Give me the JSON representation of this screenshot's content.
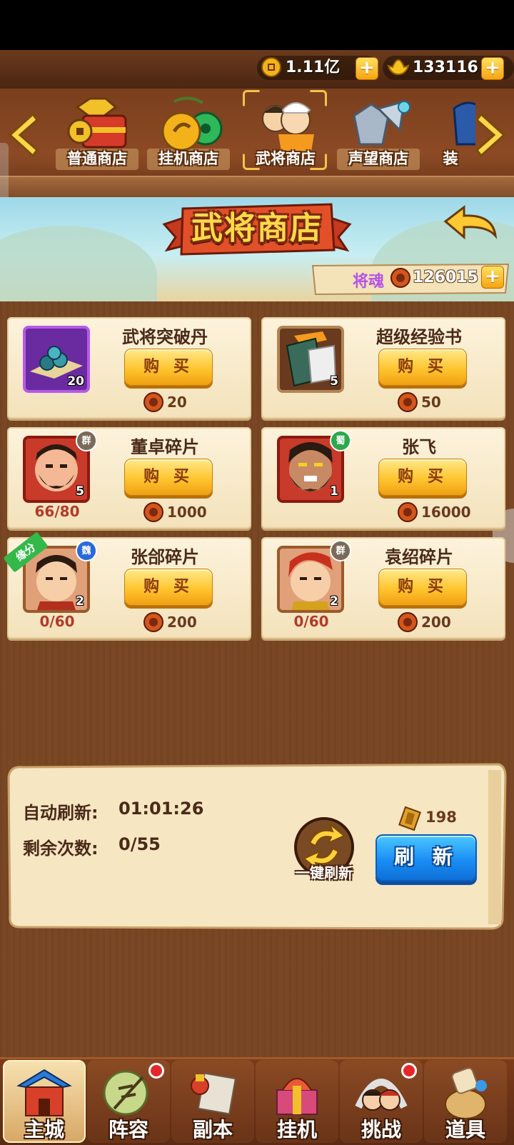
{
  "currency": {
    "coins": "1.11亿",
    "ingots": "133116"
  },
  "shop_tabs": [
    {
      "label": "普通商店",
      "icon": "treasure-chest-icon",
      "selected": false
    },
    {
      "label": "挂机商店",
      "icon": "coin-jade-icon",
      "selected": false
    },
    {
      "label": "武将商店",
      "icon": "general-portrait-icon",
      "selected": true
    },
    {
      "label": "声望商店",
      "icon": "armor-icon",
      "selected": false
    },
    {
      "label": "装",
      "icon": "equipment-icon",
      "selected": false
    }
  ],
  "header": {
    "title": "武将商店",
    "soul_label": "将魂",
    "soul_value": "126015"
  },
  "items": [
    {
      "name": "武将突破丹",
      "count": "20",
      "price": "20",
      "buy_label": "购 买",
      "progress": "",
      "faction": "",
      "icon": "breakthrough-pill-icon"
    },
    {
      "name": "超级经验书",
      "count": "5",
      "price": "50",
      "buy_label": "购 买",
      "progress": "",
      "faction": "",
      "icon": "exp-book-icon"
    },
    {
      "name": "董卓碎片",
      "count": "5",
      "price": "1000",
      "buy_label": "购 买",
      "progress": "66/80",
      "faction": "群",
      "icon": "dongzhuo-portrait-icon"
    },
    {
      "name": "张飞",
      "count": "1",
      "price": "16000",
      "buy_label": "购 买",
      "progress": "",
      "faction": "蜀",
      "icon": "zhangfei-portrait-icon"
    },
    {
      "name": "张郃碎片",
      "count": "2",
      "price": "200",
      "buy_label": "购 买",
      "progress": "0/60",
      "faction": "魏",
      "tag": "缘分",
      "icon": "zhanghe-portrait-icon"
    },
    {
      "name": "袁绍碎片",
      "count": "2",
      "price": "200",
      "buy_label": "购 买",
      "progress": "0/60",
      "faction": "群",
      "icon": "yuanshao-portrait-icon"
    }
  ],
  "refresh": {
    "auto_label": "自动刷新:",
    "auto_time": "01:01:26",
    "remaining_label": "剩余次数:",
    "remaining_value": "0/55",
    "one_key_label": "一键刷新",
    "cost": "198",
    "refresh_label": "刷 新"
  },
  "nav": [
    {
      "label": "主城",
      "icon": "palace-icon",
      "active": true,
      "dot": false
    },
    {
      "label": "阵容",
      "icon": "lineup-icon",
      "active": false,
      "dot": true
    },
    {
      "label": "副本",
      "icon": "dungeon-icon",
      "active": false,
      "dot": false
    },
    {
      "label": "挂机",
      "icon": "idle-icon",
      "active": false,
      "dot": false
    },
    {
      "label": "挑战",
      "icon": "challenge-icon",
      "active": false,
      "dot": true
    },
    {
      "label": "道具",
      "icon": "items-bag-icon",
      "active": false,
      "dot": false
    }
  ],
  "colors": {
    "wood_brown": "#7a4724",
    "parchment": "#fdf3dc",
    "buy_gold": "#ffc530",
    "refresh_blue": "#1b8ef5"
  }
}
